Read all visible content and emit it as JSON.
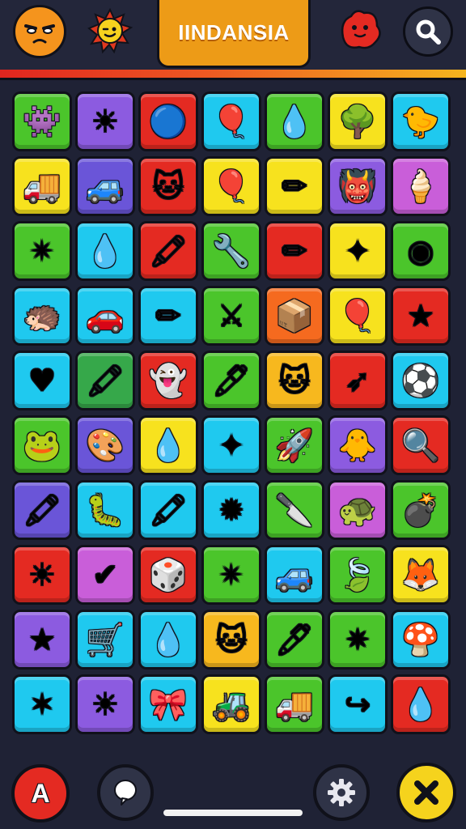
{
  "header": {
    "title": "IINDANSIA",
    "avatar_icon": "orange-smiley-face-icon",
    "sun_icon": "winking-sun-icon",
    "blob_icon": "red-blob-creature-icon",
    "search_icon": "search-icon"
  },
  "colors": {
    "background": "#1f2235",
    "accent_red": "#e0251f",
    "accent_orange": "#ee5a22",
    "accent_yellow": "#f5b51e",
    "title_tab": "#ed9b17"
  },
  "grid": {
    "columns": 7,
    "rows": 10,
    "tiles": [
      {
        "name": "pink-blob-creature",
        "color": "#4bc52b",
        "glyph": "👾"
      },
      {
        "name": "red-sun-face",
        "color": "#8c5be0",
        "glyph": "☀"
      },
      {
        "name": "blue-ball-face",
        "color": "#e42a22",
        "glyph": "🔵"
      },
      {
        "name": "red-balloon-face",
        "color": "#1fc9ef",
        "glyph": "🎈"
      },
      {
        "name": "yellow-drop-face",
        "color": "#4bc52b",
        "glyph": "💧"
      },
      {
        "name": "green-bush",
        "color": "#f7e21e",
        "glyph": "🌳"
      },
      {
        "name": "yellow-creature",
        "color": "#1fc9ef",
        "glyph": "🐤"
      },
      {
        "name": "purple-truck",
        "color": "#f7e21e",
        "glyph": "🚚"
      },
      {
        "name": "blue-car",
        "color": "#6a55d8",
        "glyph": "🚙"
      },
      {
        "name": "yellow-cat-creature",
        "color": "#e42a22",
        "glyph": "🐱"
      },
      {
        "name": "blue-balloon-face",
        "color": "#f7e21e",
        "glyph": "🎈"
      },
      {
        "name": "blue-crayon",
        "color": "#f7e21e",
        "glyph": "✏"
      },
      {
        "name": "blue-monster-face",
        "color": "#8c5be0",
        "glyph": "👹"
      },
      {
        "name": "striped-cone",
        "color": "#c95ed9",
        "glyph": "🍦"
      },
      {
        "name": "orange-star-shape",
        "color": "#4bc52b",
        "glyph": "✴"
      },
      {
        "name": "yellow-drop-face",
        "color": "#1fc9ef",
        "glyph": "💧"
      },
      {
        "name": "purple-crayon",
        "color": "#e42a22",
        "glyph": "🖍"
      },
      {
        "name": "wrench-tool",
        "color": "#4bc52b",
        "glyph": "🔧"
      },
      {
        "name": "green-pencil",
        "color": "#e42a22",
        "glyph": "✏"
      },
      {
        "name": "purple-pinwheel",
        "color": "#f7e21e",
        "glyph": "✦"
      },
      {
        "name": "yellow-orb",
        "color": "#4bc52b",
        "glyph": "◉"
      },
      {
        "name": "orange-spiky-creature",
        "color": "#1fc9ef",
        "glyph": "🦔"
      },
      {
        "name": "red-car",
        "color": "#1fc9ef",
        "glyph": "🚗"
      },
      {
        "name": "purple-pencil",
        "color": "#1fc9ef",
        "glyph": "✏"
      },
      {
        "name": "crossed-swords",
        "color": "#4bc52b",
        "glyph": "⚔"
      },
      {
        "name": "yellow-box",
        "color": "#f56a1f",
        "glyph": "📦"
      },
      {
        "name": "pink-balloon",
        "color": "#f7e21e",
        "glyph": "🎈"
      },
      {
        "name": "yellow-star",
        "color": "#e42a22",
        "glyph": "★"
      },
      {
        "name": "pink-heart",
        "color": "#1fc9ef",
        "glyph": "♥"
      },
      {
        "name": "orange-crayon",
        "color": "#36a84a",
        "glyph": "🖍"
      },
      {
        "name": "pink-blob-face",
        "color": "#e42a22",
        "glyph": "👻"
      },
      {
        "name": "purple-marker",
        "color": "#4bc52b",
        "glyph": "🖊"
      },
      {
        "name": "orange-cat-creature",
        "color": "#f7b81e",
        "glyph": "🐱"
      },
      {
        "name": "green-arrow-pencil",
        "color": "#e42a22",
        "glyph": "➶"
      },
      {
        "name": "striped-ball",
        "color": "#1fc9ef",
        "glyph": "⚽"
      },
      {
        "name": "yellow-frog-face",
        "color": "#4bc52b",
        "glyph": "🐸"
      },
      {
        "name": "paint-palette-box",
        "color": "#6a55d8",
        "glyph": "🎨"
      },
      {
        "name": "pink-drop-face",
        "color": "#f7e21e",
        "glyph": "💧"
      },
      {
        "name": "pinwheel-star",
        "color": "#1fc9ef",
        "glyph": "✦"
      },
      {
        "name": "blue-rocket",
        "color": "#4bc52b",
        "glyph": "🚀"
      },
      {
        "name": "yellow-blob-face",
        "color": "#8c5be0",
        "glyph": "🐥"
      },
      {
        "name": "magnifier",
        "color": "#e42a22",
        "glyph": "🔍"
      },
      {
        "name": "blue-crayon",
        "color": "#6a55d8",
        "glyph": "🖍"
      },
      {
        "name": "green-caterpillar",
        "color": "#1fc9ef",
        "glyph": "🐛"
      },
      {
        "name": "green-crayon",
        "color": "#1fc9ef",
        "glyph": "🖍"
      },
      {
        "name": "orange-spiky-sun",
        "color": "#1fc9ef",
        "glyph": "✹"
      },
      {
        "name": "red-pocket-knife",
        "color": "#4bc52b",
        "glyph": "🔪"
      },
      {
        "name": "green-creature",
        "color": "#c95ed9",
        "glyph": "🐢"
      },
      {
        "name": "blue-bomb",
        "color": "#4bc52b",
        "glyph": "💣"
      },
      {
        "name": "orange-sun-face",
        "color": "#e42a22",
        "glyph": "☀"
      },
      {
        "name": "yellow-check-badge",
        "color": "#c95ed9",
        "glyph": "✔"
      },
      {
        "name": "dice-cube",
        "color": "#e42a22",
        "glyph": "🎲"
      },
      {
        "name": "orange-star-shape",
        "color": "#4bc52b",
        "glyph": "✴"
      },
      {
        "name": "red-jeep",
        "color": "#1fc9ef",
        "glyph": "🚙"
      },
      {
        "name": "green-leaf-blob",
        "color": "#4bc52b",
        "glyph": "🍃"
      },
      {
        "name": "orange-cat-creature",
        "color": "#f7e21e",
        "glyph": "🦊"
      },
      {
        "name": "yellow-star",
        "color": "#8c5be0",
        "glyph": "★"
      },
      {
        "name": "blue-cart",
        "color": "#1fc9ef",
        "glyph": "🛒"
      },
      {
        "name": "yellow-drop-face",
        "color": "#1fc9ef",
        "glyph": "💧"
      },
      {
        "name": "pink-cat-creature",
        "color": "#f7b81e",
        "glyph": "🐱"
      },
      {
        "name": "red-marker",
        "color": "#4bc52b",
        "glyph": "🖊"
      },
      {
        "name": "yellow-starburst",
        "color": "#4bc52b",
        "glyph": "✷"
      },
      {
        "name": "orange-mushroom-face",
        "color": "#1fc9ef",
        "glyph": "🍄"
      },
      {
        "name": "yellow-star-face",
        "color": "#1fc9ef",
        "glyph": "✶"
      },
      {
        "name": "yellow-sun-face",
        "color": "#8c5be0",
        "glyph": "☀"
      },
      {
        "name": "striped-ribbon-ball",
        "color": "#1fc9ef",
        "glyph": "🎀"
      },
      {
        "name": "green-tractor",
        "color": "#f7e21e",
        "glyph": "🚜"
      },
      {
        "name": "purple-truck",
        "color": "#4bc52b",
        "glyph": "🚚"
      },
      {
        "name": "yellow-curved-arrow",
        "color": "#1fc9ef",
        "glyph": "↪"
      },
      {
        "name": "purple-drop-face",
        "color": "#e42a22",
        "glyph": "💧"
      }
    ]
  },
  "footer": {
    "a_button_label": "A",
    "a_button_icon": "a-letter-icon",
    "chat_icon": "speech-bubble-icon",
    "gear_icon": "gear-icon",
    "close_icon": "close-icon"
  }
}
